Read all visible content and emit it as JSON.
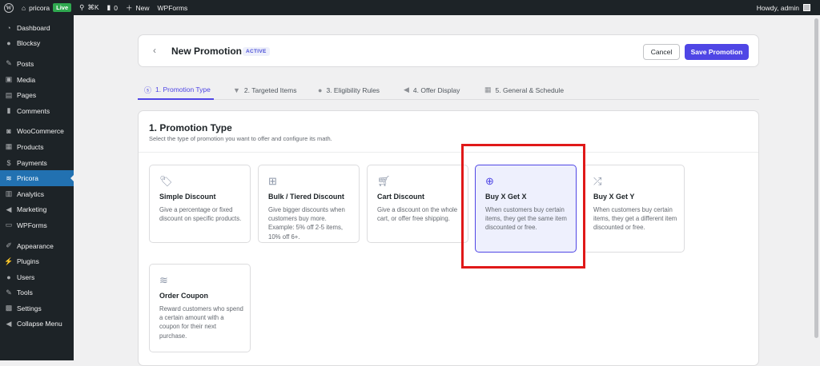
{
  "adminbar": {
    "site_name": "pricora",
    "live_badge": "Live",
    "shortcut": "⌘K",
    "comments_count": "0",
    "new_label": "New",
    "wpforms_label": "WPForms",
    "howdy": "Howdy, admin"
  },
  "sidebar": {
    "items": [
      {
        "label": "Dashboard",
        "icon": "dashboard-icon"
      },
      {
        "label": "Blocksy",
        "icon": "blocksy-icon"
      },
      {
        "label": "Posts",
        "icon": "pin-icon"
      },
      {
        "label": "Media",
        "icon": "media-icon"
      },
      {
        "label": "Pages",
        "icon": "pages-icon"
      },
      {
        "label": "Comments",
        "icon": "comment-icon"
      },
      {
        "label": "WooCommerce",
        "icon": "woocommerce-icon"
      },
      {
        "label": "Products",
        "icon": "products-icon"
      },
      {
        "label": "Payments",
        "icon": "payments-icon"
      },
      {
        "label": "Pricora",
        "icon": "pricora-icon",
        "active": true
      },
      {
        "label": "Analytics",
        "icon": "analytics-icon"
      },
      {
        "label": "Marketing",
        "icon": "megaphone-icon"
      },
      {
        "label": "WPForms",
        "icon": "wpforms-icon"
      },
      {
        "label": "Appearance",
        "icon": "brush-icon"
      },
      {
        "label": "Plugins",
        "icon": "plugin-icon"
      },
      {
        "label": "Users",
        "icon": "user-icon"
      },
      {
        "label": "Tools",
        "icon": "wrench-icon"
      },
      {
        "label": "Settings",
        "icon": "settings-icon"
      },
      {
        "label": "Collapse Menu",
        "icon": "collapse-icon"
      }
    ]
  },
  "header": {
    "title": "New Promotion",
    "status": "ACTIVE",
    "cancel_label": "Cancel",
    "save_label": "Save Promotion"
  },
  "tabs": [
    {
      "label": "1. Promotion Type",
      "icon": "dollar-circle-icon",
      "active": true
    },
    {
      "label": "2. Targeted Items",
      "icon": "funnel-icon"
    },
    {
      "label": "3. Eligibility Rules",
      "icon": "person-icon"
    },
    {
      "label": "4. Offer Display",
      "icon": "megaphone-icon"
    },
    {
      "label": "5. General & Schedule",
      "icon": "calendar-icon"
    }
  ],
  "section": {
    "title": "1. Promotion Type",
    "subtitle": "Select the type of promotion you want to offer and configure its math."
  },
  "cards": [
    {
      "title": "Simple Discount",
      "desc": "Give a percentage or fixed discount on specific products.",
      "icon": "tag-icon"
    },
    {
      "title": "Bulk / Tiered Discount",
      "desc": "Give bigger discounts when customers buy more. Example: 5% off 2-5 items, 10% off 6+.",
      "icon": "hierarchy-icon"
    },
    {
      "title": "Cart Discount",
      "desc": "Give a discount on the whole cart, or offer free shipping.",
      "icon": "cart-icon"
    },
    {
      "title": "Buy X Get X",
      "desc": "When customers buy certain items, they get the same item discounted or free.",
      "icon": "plus-circle-icon",
      "selected": true
    },
    {
      "title": "Buy X Get Y",
      "desc": "When customers buy certain items, they get a different item discounted or free.",
      "icon": "shuffle-icon"
    },
    {
      "title": "Order Coupon",
      "desc": "Reward customers who spend a certain amount with a coupon for their next purchase.",
      "icon": "coupon-icon"
    }
  ],
  "colors": {
    "accent": "#4f46e5",
    "admin_dark": "#1d2327",
    "admin_active": "#2271b1",
    "highlight_box": "#e01919"
  }
}
